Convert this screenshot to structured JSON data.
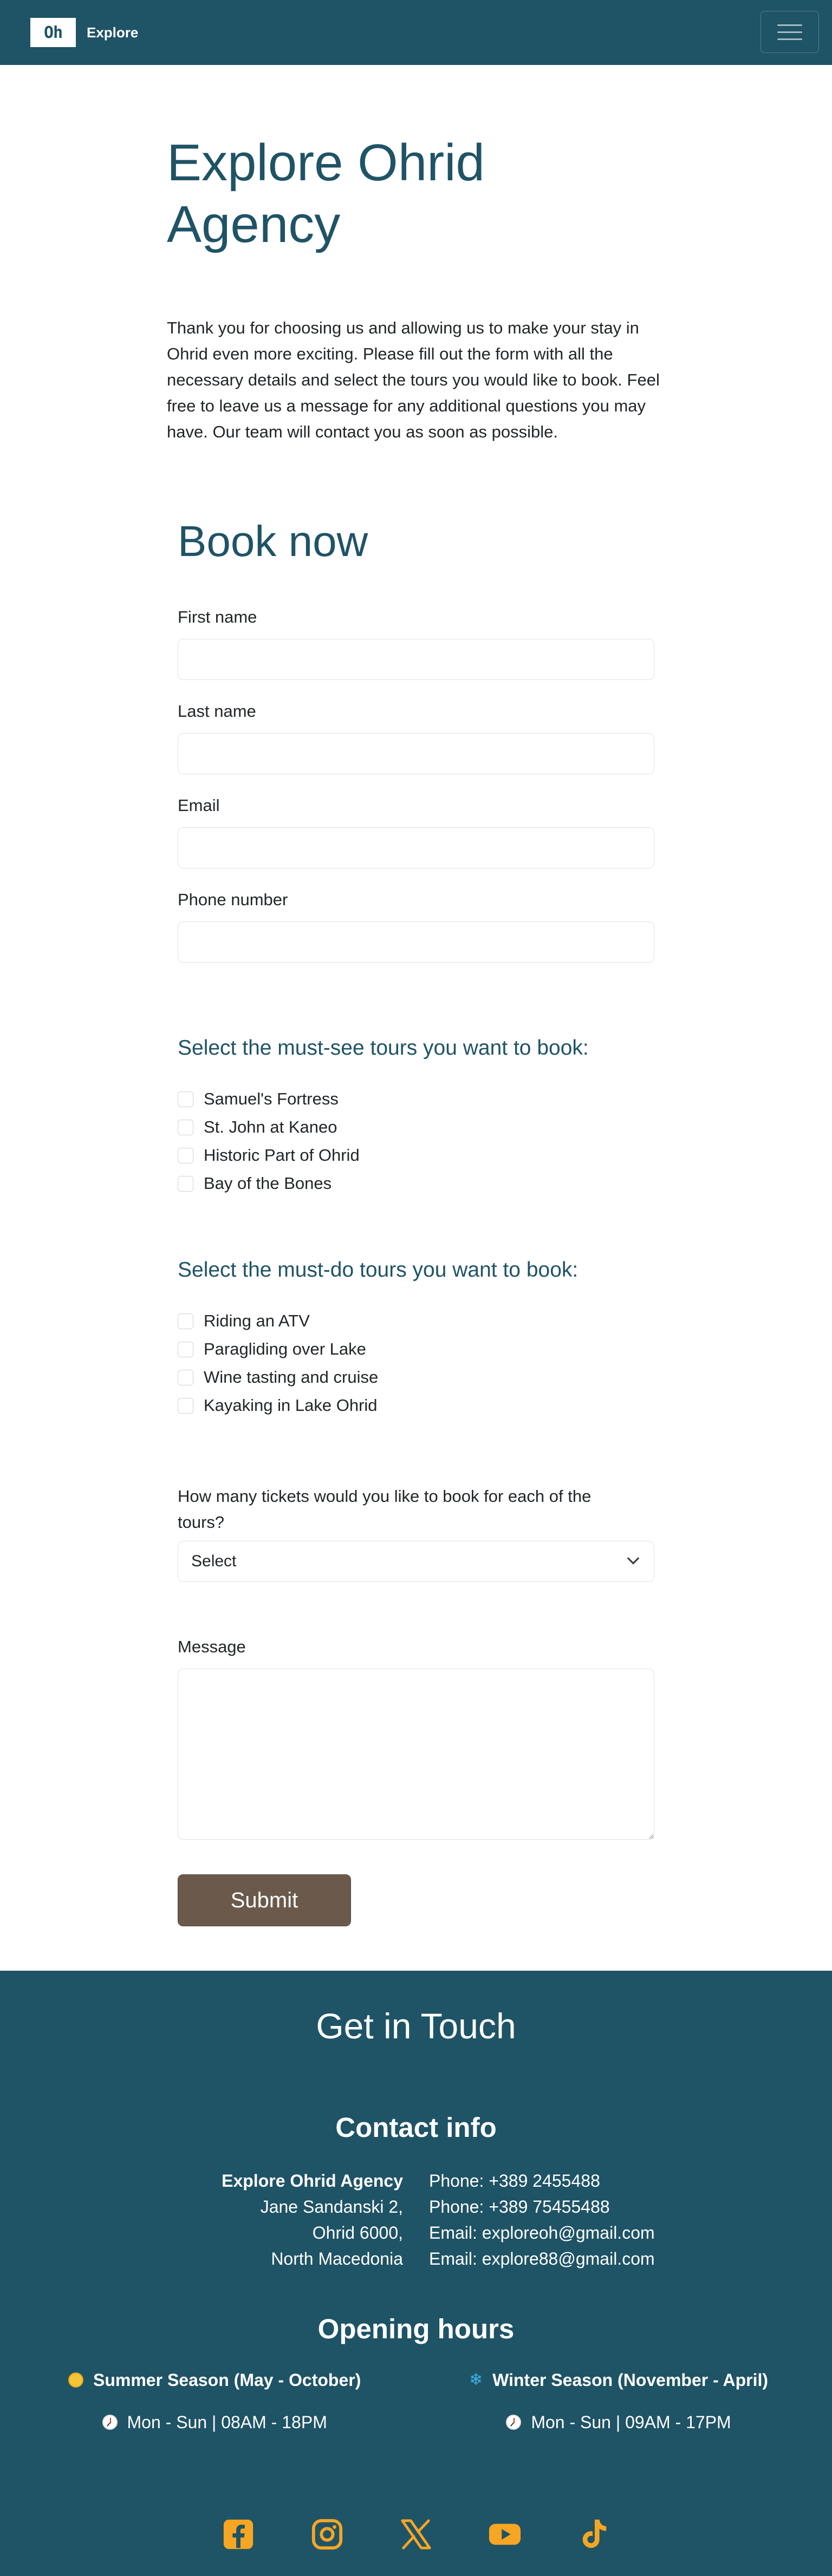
{
  "nav": {
    "logo_text": "Oh",
    "brand_text": "Explore",
    "menu_icon": "hamburger-menu-icon"
  },
  "intro": {
    "title": "Explore Ohrid Agency",
    "text": "Thank you for choosing us and allowing us to make your stay in Ohrid even more exciting. Please fill out the form with all the necessary details and select the tours you would like to book. Feel free to leave us a message for any additional questions you may have. Our team will contact you as soon as possible."
  },
  "form": {
    "title": "Book now",
    "first_name_label": "First name",
    "first_name_value": "",
    "last_name_label": "Last name",
    "last_name_value": "",
    "email_label": "Email",
    "email_value": "",
    "phone_label": "Phone number",
    "phone_value": "",
    "must_see": {
      "heading": "Select the must-see tours you want to book:",
      "items": [
        "Samuel's Fortress",
        "St. John at Kaneo",
        "Historic Part of Ohrid",
        "Bay of the Bones"
      ]
    },
    "must_do": {
      "heading": "Select the must-do tours you want to book:",
      "items": [
        "Riding an ATV",
        "Paragliding over Lake",
        "Wine tasting and cruise",
        "Kayaking in Lake Ohrid"
      ]
    },
    "tickets_label": "How many tickets would you like to book for each of the tours?",
    "tickets_selected": "Select",
    "message_label": "Message",
    "message_value": "",
    "submit_label": "Submit"
  },
  "footer": {
    "title": "Get in Touch",
    "contact_title": "Contact info",
    "address": {
      "agency": "Explore Ohrid Agency",
      "street": "Jane Sandanski 2,",
      "city": "Ohrid 6000,",
      "country": "North Macedonia"
    },
    "contacts": [
      "Phone: +389 2455488",
      "Phone: +389 75455488",
      "Email: exploreoh@gmail.com",
      "Email: explore88@gmail.com"
    ],
    "hours_title": "Opening hours",
    "summer": {
      "name": "Summer Season (May - October)",
      "hours": "Mon - Sun | 08AM - 18PM",
      "icon": "sun-icon"
    },
    "winter": {
      "name": "Winter Season (November - April)",
      "hours": "Mon - Sun | 09AM - 17PM",
      "icon": "snowflake-icon"
    },
    "social_icons": [
      "facebook-icon",
      "instagram-icon",
      "x-twitter-icon",
      "youtube-icon",
      "tiktok-icon"
    ],
    "social_color": "#f6a623"
  },
  "colors": {
    "primary": "#1f5366",
    "submit": "#6b5a4b",
    "accent": "#f6a623"
  }
}
